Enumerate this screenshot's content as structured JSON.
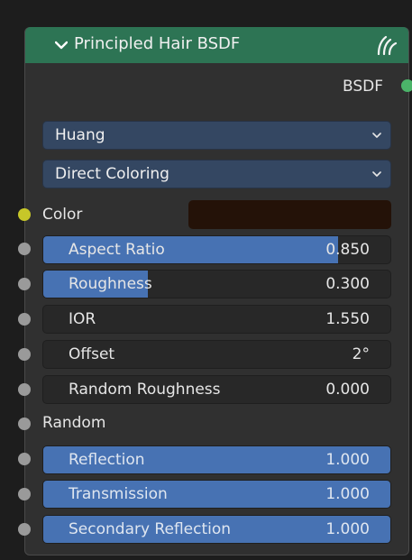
{
  "node": {
    "title": "Principled Hair BSDF",
    "header_color": "#2d7454",
    "output_label": "BSDF"
  },
  "dropdowns": [
    {
      "label": "Huang"
    },
    {
      "label": "Direct Coloring"
    }
  ],
  "color_input": {
    "label": "Color",
    "swatch_color": "#241208"
  },
  "fields": [
    {
      "label": "Aspect Ratio",
      "value": "0.850",
      "fill": 0.85
    },
    {
      "label": "Roughness",
      "value": "0.300",
      "fill": 0.3
    },
    {
      "label": "IOR",
      "value": "1.550",
      "fill": 0
    },
    {
      "label": "Offset",
      "value": "2°",
      "fill": 0
    },
    {
      "label": "Random Roughness",
      "value": "0.000",
      "fill": 0
    }
  ],
  "random_input": {
    "label": "Random"
  },
  "fields2": [
    {
      "label": "Reflection",
      "value": "1.000",
      "fill": 1
    },
    {
      "label": "Transmission",
      "value": "1.000",
      "fill": 1
    },
    {
      "label": "Secondary Reflection",
      "value": "1.000",
      "fill": 1
    }
  ]
}
